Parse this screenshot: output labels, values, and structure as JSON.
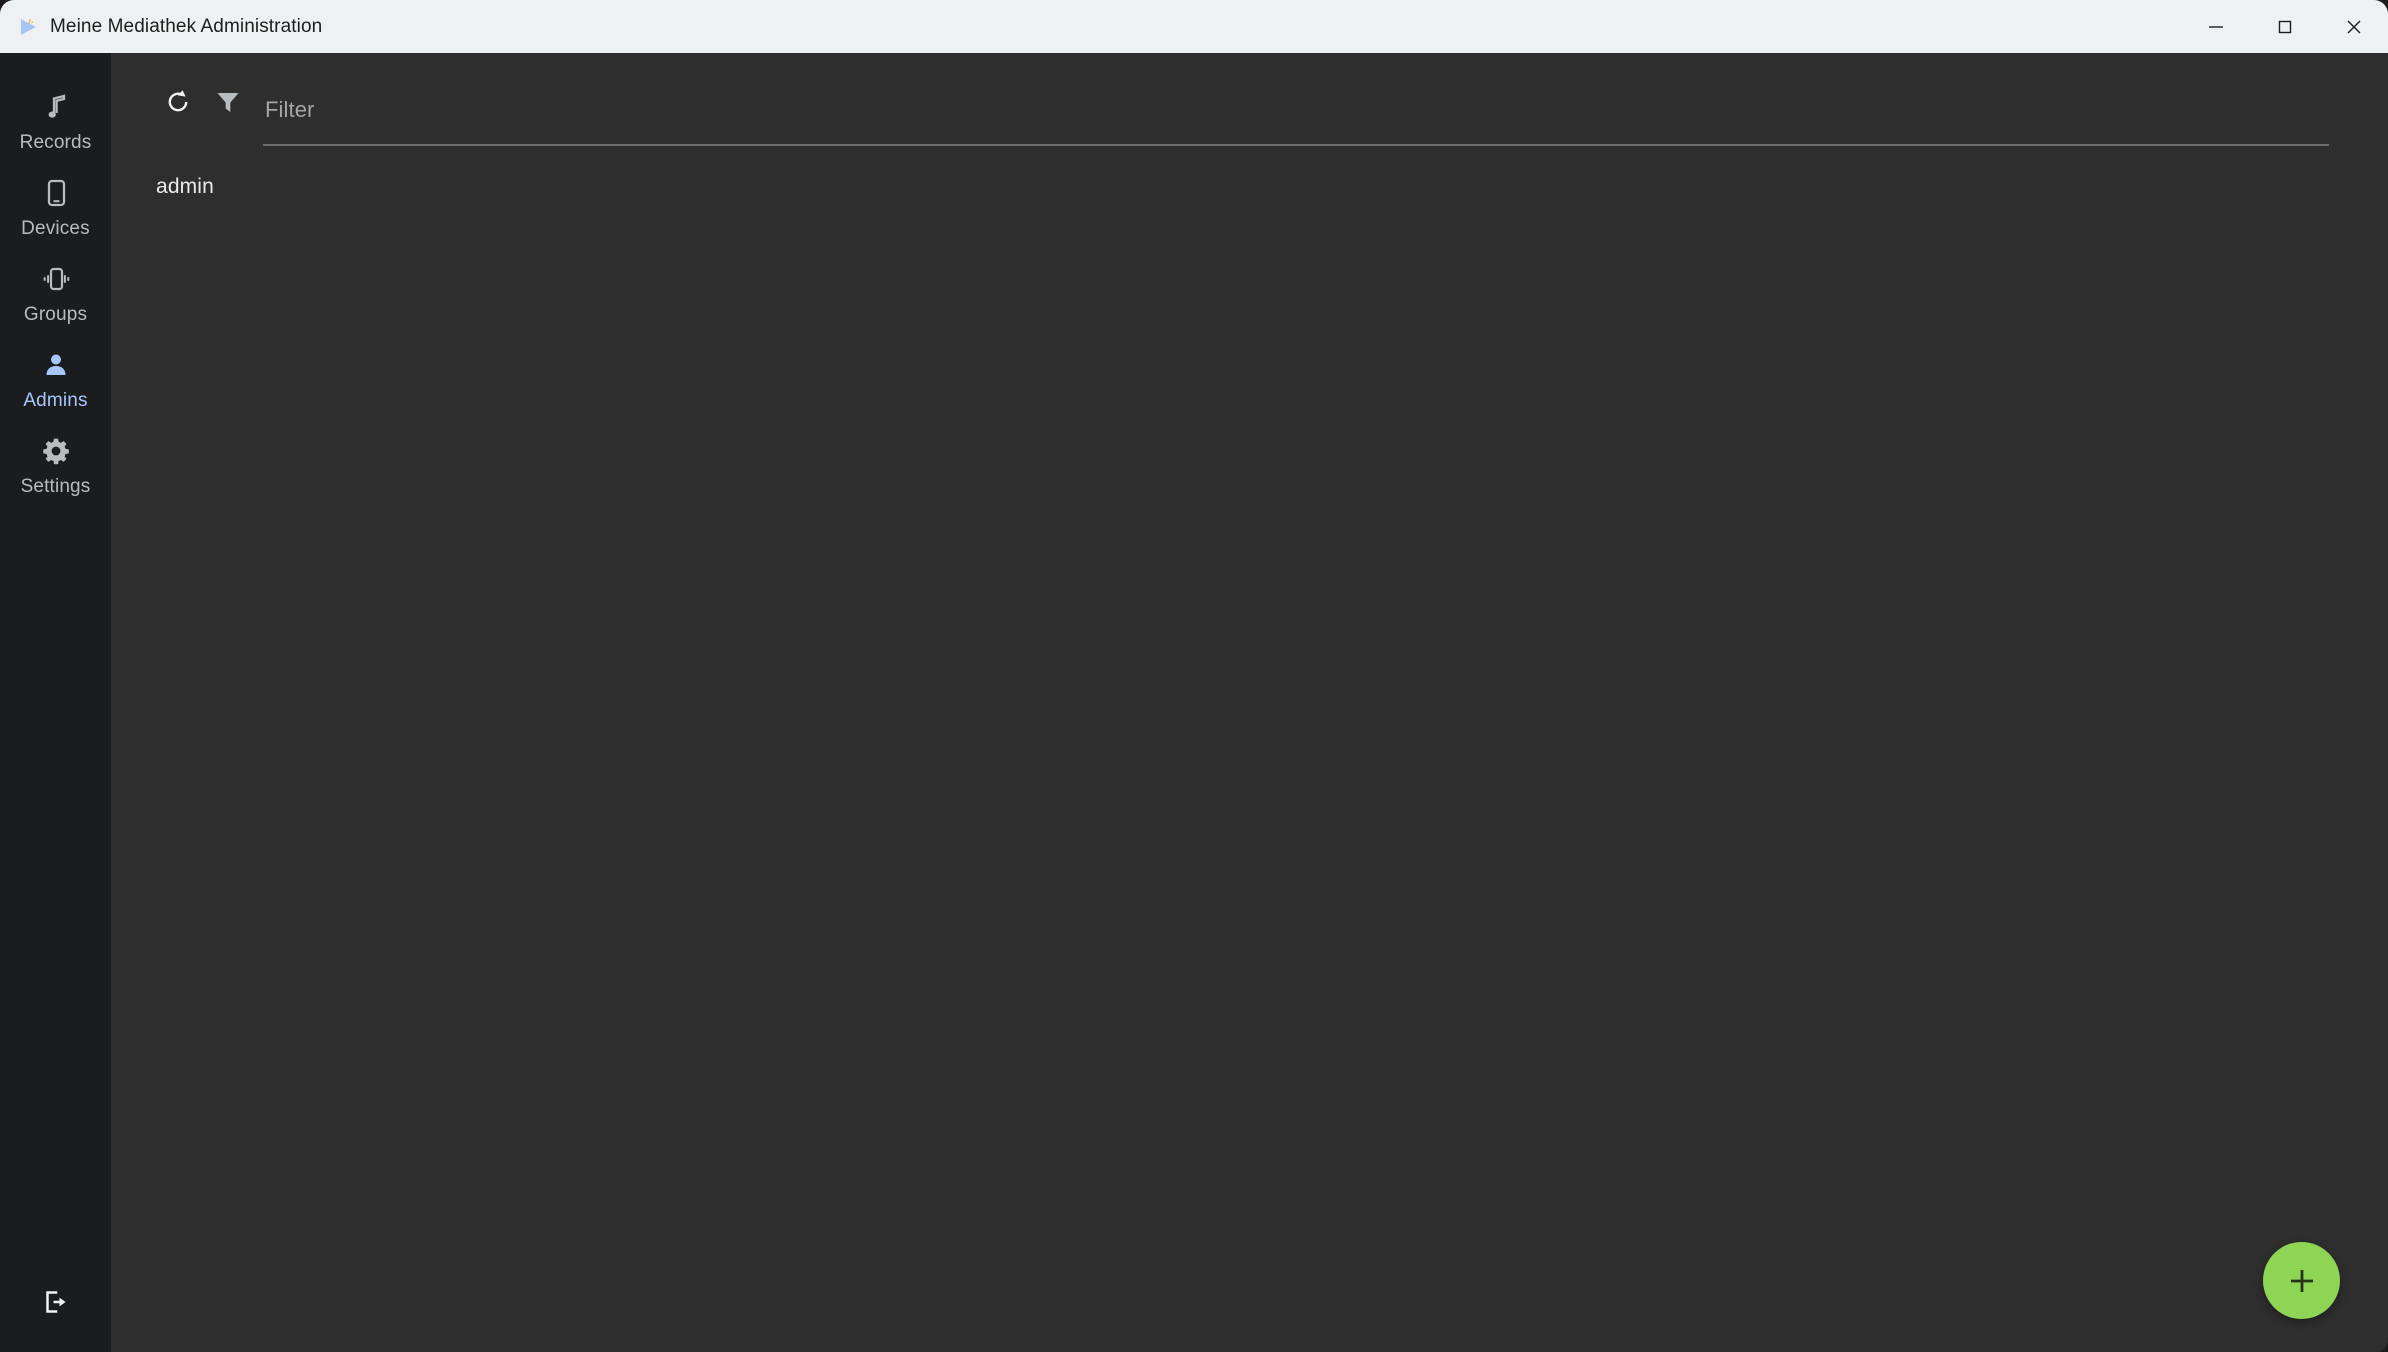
{
  "window": {
    "title": "Meine Mediathek Administration",
    "app_icon": "play-triangle-icon",
    "controls": {
      "minimize": "minimize-icon",
      "maximize": "maximize-icon",
      "close": "close-icon"
    },
    "colors": {
      "titlebar_bg": "#eef1f2",
      "sidebar_bg": "#1a1c1e",
      "content_bg": "#2e2e2e",
      "accent": "#a7c6fb",
      "fab_green": "#8ed455",
      "label": "#b9bcbe"
    }
  },
  "sidebar": {
    "items": [
      {
        "label": "Records",
        "icon": "music-note-icon",
        "active": false
      },
      {
        "label": "Devices",
        "icon": "smartphone-icon",
        "active": false
      },
      {
        "label": "Groups",
        "icon": "vibrating-phone-icon",
        "active": false
      },
      {
        "label": "Admins",
        "icon": "person-icon",
        "active": true
      },
      {
        "label": "Settings",
        "icon": "gear-icon",
        "active": false
      }
    ],
    "logout": {
      "label": "Logout",
      "icon": "logout-icon"
    }
  },
  "toolbar": {
    "refresh": {
      "label": "Refresh",
      "icon": "refresh-icon"
    },
    "filter": {
      "label": "Filter",
      "icon": "funnel-icon"
    },
    "filter_input": {
      "value": "",
      "placeholder": "Filter"
    }
  },
  "list": {
    "items": [
      {
        "label": "admin"
      }
    ]
  },
  "fab": {
    "label": "+",
    "icon": "plus-icon",
    "tooltip": "Add"
  }
}
